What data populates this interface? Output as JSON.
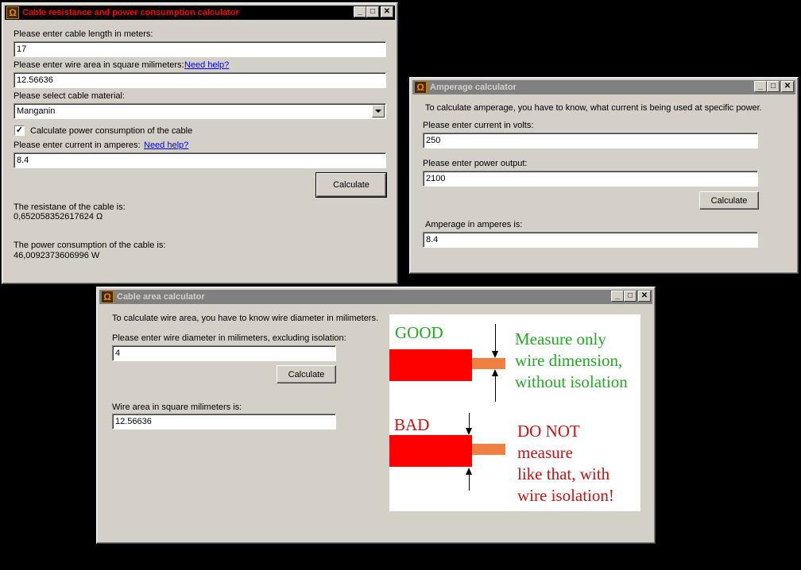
{
  "resistance_window": {
    "title": "Cable resistance and power consumption calculator",
    "length_label": "Please enter cable length in meters:",
    "length_value": "17",
    "area_label": "Please enter wire area in square milimeters:",
    "area_help": "Need help?",
    "area_value": "12.56636",
    "material_label": "Please select cable material:",
    "material_value": "Manganin",
    "power_checkbox_label": "Calculate power consumption of the cable",
    "power_checked": true,
    "current_label": "Please enter current in amperes:",
    "current_help": "Need help?",
    "current_value": "8.4",
    "calculate_label": "Calculate",
    "resistance_result_label": "The resistane of the cable is:",
    "resistance_result_value": "0,652058352617624 Ω",
    "power_result_label": "The power consumption of the cable is:",
    "power_result_value": "46,0092373606996 W"
  },
  "amperage_window": {
    "title": "Amperage calculator",
    "intro": "To calculate amperage, you have to know, what current is being used at specific power.",
    "volts_label": "Please enter current in volts:",
    "volts_value": "250",
    "power_label": "Please enter power output:",
    "power_value": "2100",
    "calculate_label": "Calculate",
    "result_label": "Amperage in amperes is:",
    "result_value": "8.4"
  },
  "area_window": {
    "title": "Cable area calculator",
    "intro": "To calculate wire area, you have to know wire diameter in milimeters.",
    "diameter_label": "Please enter wire diameter in milimeters, excluding isolation:",
    "diameter_value": "4",
    "calculate_label": "Calculate",
    "result_label": "Wire area in square milimeters is:",
    "result_value": "12.56636",
    "illustration": {
      "good_label": "GOOD",
      "good_text": [
        "Measure only",
        "wire dimension,",
        "without isolation"
      ],
      "bad_label": "BAD",
      "bad_text": [
        "DO NOT",
        "measure",
        "like that, with",
        "wire isolation!"
      ]
    }
  },
  "titlebar_buttons": {
    "minimize": "_",
    "maximize": "□",
    "close": "✕"
  },
  "colors": {
    "window_face": "#d4d0c8",
    "active_title_bg": "#000000",
    "active_title_text": "#ff0000",
    "inactive_title_bg": "#808080",
    "good_color": "#22aa22",
    "bad_color": "#cc1111",
    "wire_core": "#ff0000",
    "wire_end": "#f08040"
  }
}
